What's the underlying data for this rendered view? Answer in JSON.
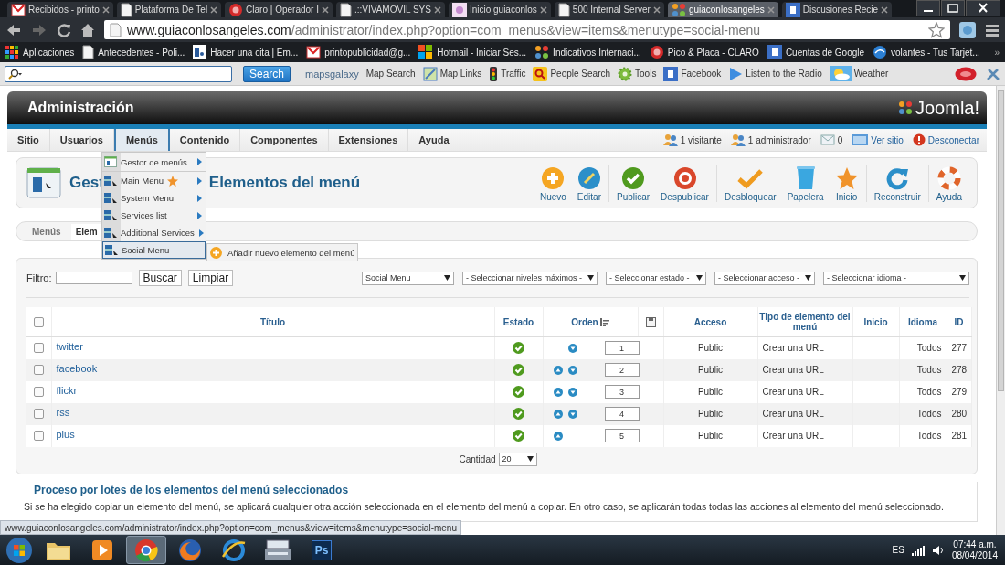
{
  "browser": {
    "tabs": [
      {
        "title": "Recibidos - printo",
        "kind": "mail",
        "selected": false
      },
      {
        "title": "Plataforma De Tel",
        "kind": "page",
        "selected": false
      },
      {
        "title": "Claro | Operador I",
        "kind": "circle",
        "selected": false
      },
      {
        "title": ".::VIVAMOVIL SYS",
        "kind": "page",
        "selected": false
      },
      {
        "title": "Inicio guiaconlos",
        "kind": "flower",
        "selected": false
      },
      {
        "title": "500 Internal Server",
        "kind": "page",
        "selected": false
      },
      {
        "title": "guiaconlosangeles",
        "kind": "joomla",
        "selected": true
      },
      {
        "title": "Discusiones Recie",
        "kind": "square",
        "selected": false
      }
    ],
    "url": {
      "host": "www.guiaconlosangeles.com",
      "path": "/administrator/index.php?option=com_menus&view=items&menutype=social-menu"
    },
    "bookmarks": [
      {
        "label": "Aplicaciones",
        "kind": "apps"
      },
      {
        "label": "Antecedentes - Poli...",
        "kind": "page"
      },
      {
        "label": "Hacer una cita | Em...",
        "kind": "document"
      },
      {
        "label": "printopublicidad@g...",
        "kind": "mail"
      },
      {
        "label": "Hotmail - Iniciar Ses...",
        "kind": "grid"
      },
      {
        "label": "Indicativos Internaci...",
        "kind": "joomla"
      },
      {
        "label": "Pico & Placa - CLARO",
        "kind": "circle"
      },
      {
        "label": "Cuentas de Google",
        "kind": "square"
      },
      {
        "label": "volantes - Tus Tarjet...",
        "kind": "globe"
      }
    ],
    "bookmarks_more": "»"
  },
  "ask_toolbar": {
    "search_button": "Search",
    "logo": "mapsgalaxy",
    "items": [
      {
        "label": "Map Search",
        "kind": "text"
      },
      {
        "label": "Map Links",
        "kind": "map"
      },
      {
        "label": "Traffic",
        "kind": "traffic"
      },
      {
        "label": "People Search",
        "kind": "search"
      },
      {
        "label": "Tools",
        "kind": "gear"
      },
      {
        "label": "Facebook",
        "kind": "square"
      },
      {
        "label": "Listen to the Radio",
        "kind": "play"
      },
      {
        "label": "Weather",
        "kind": "weather"
      }
    ]
  },
  "header": {
    "title": "Administración",
    "logo": "Joomla!"
  },
  "menu": [
    {
      "label": "Sitio",
      "selected": false
    },
    {
      "label": "Usuarios",
      "selected": false
    },
    {
      "label": "Menús",
      "selected": true
    },
    {
      "label": "Contenido",
      "selected": false
    },
    {
      "label": "Componentes",
      "selected": false
    },
    {
      "label": "Extensiones",
      "selected": false
    },
    {
      "label": "Ayuda",
      "selected": false
    }
  ],
  "status": [
    {
      "label": "1 visitante",
      "kind": "users",
      "link": false
    },
    {
      "label": "1 administrador",
      "kind": "users",
      "link": false
    },
    {
      "label": "0",
      "kind": "mail",
      "link": false
    },
    {
      "label": "Ver sitio",
      "kind": "screen",
      "link": true
    },
    {
      "label": "Desconectar",
      "kind": "power",
      "link": true
    }
  ],
  "title": {
    "start": "Gest",
    "end": "Elementos del menú"
  },
  "toolbar": {
    "groups": [
      {
        "buttons": [
          {
            "label": "Nuevo",
            "kind": "new"
          },
          {
            "label": "Editar",
            "kind": "edit"
          }
        ]
      },
      {
        "buttons": [
          {
            "label": "Publicar",
            "kind": "publish"
          },
          {
            "label": "Despublicar",
            "kind": "unpublish"
          }
        ]
      },
      {
        "buttons": [
          {
            "label": "Desbloquear",
            "kind": "checkin"
          },
          {
            "label": "Papelera",
            "kind": "trash"
          },
          {
            "label": "Inicio",
            "kind": "star"
          }
        ]
      },
      {
        "buttons": [
          {
            "label": "Reconstruir",
            "kind": "refresh"
          }
        ]
      },
      {
        "buttons": [
          {
            "label": "Ayuda",
            "kind": "help"
          }
        ]
      }
    ]
  },
  "submenu": [
    {
      "label": "Menús",
      "selected": false
    },
    {
      "label": "Elem",
      "selected": true
    }
  ],
  "filter": {
    "label": "Filtro:",
    "buttons": [
      "Buscar",
      "Limpiar"
    ],
    "selects": [
      "Social Menu",
      "- Seleccionar niveles máximos -",
      "- Seleccionar estado -",
      "- Seleccionar acceso -",
      "- Seleccionar idioma -"
    ]
  },
  "table": {
    "select_all_checked": false,
    "columns": [
      {
        "label": "Título",
        "kind": "text"
      },
      {
        "label": "Estado",
        "kind": "text"
      },
      {
        "label": "Orden",
        "kind": "sort"
      },
      {
        "kind": "save"
      },
      {
        "label": "Acceso",
        "kind": "text"
      },
      {
        "label": "Tipo de elemento del menú",
        "kind": "text"
      },
      {
        "label": "Inicio",
        "kind": "text"
      },
      {
        "label": "Idioma",
        "kind": "text"
      },
      {
        "label": "ID",
        "kind": "text"
      }
    ],
    "rows": [
      {
        "title": "twitter",
        "checked": false,
        "published": true,
        "up": false,
        "down": true,
        "order": "1",
        "access": "Public",
        "type": "Crear una URL",
        "language": "Todos",
        "id": "277"
      },
      {
        "title": "facebook",
        "checked": false,
        "published": true,
        "up": true,
        "down": true,
        "order": "2",
        "access": "Public",
        "type": "Crear una URL",
        "language": "Todos",
        "id": "278"
      },
      {
        "title": "flickr",
        "checked": false,
        "published": true,
        "up": true,
        "down": true,
        "order": "3",
        "access": "Public",
        "type": "Crear una URL",
        "language": "Todos",
        "id": "279"
      },
      {
        "title": "rss",
        "checked": false,
        "published": true,
        "up": true,
        "down": true,
        "order": "4",
        "access": "Public",
        "type": "Crear una URL",
        "language": "Todos",
        "id": "280"
      },
      {
        "title": "plus",
        "checked": false,
        "published": true,
        "up": true,
        "down": false,
        "order": "5",
        "access": "Public",
        "type": "Crear una URL",
        "language": "Todos",
        "id": "281"
      }
    ]
  },
  "pagination": {
    "label": "Cantidad",
    "value": "20"
  },
  "batch": {
    "legend": "Proceso por lotes de los elementos del menú seleccionados",
    "text": "Si se ha elegido copiar un elemento del menú, se aplicará cualquier otra acción seleccionada en el elemento del menú a copiar. En otro caso, se aplicarán todas todas las acciones al elemento del menú seleccionado."
  },
  "dropdown": {
    "items": [
      {
        "label": "Gestor de menús",
        "kind": "manager",
        "default": false,
        "arrow": true,
        "selected": false
      },
      {
        "label": "Main Menu",
        "kind": "menu",
        "default": true,
        "arrow": true,
        "selected": false
      },
      {
        "label": "System Menu",
        "kind": "menu",
        "default": false,
        "arrow": true,
        "selected": false
      },
      {
        "label": "Services list",
        "kind": "menu",
        "default": false,
        "arrow": true,
        "selected": false
      },
      {
        "label": "Additional Services",
        "kind": "menu",
        "default": false,
        "arrow": true,
        "selected": false
      },
      {
        "label": "Social Menu",
        "kind": "menu",
        "default": false,
        "arrow": false,
        "selected": true
      }
    ],
    "submenu": [
      {
        "label": "Añadir nuevo elemento del menú"
      }
    ]
  },
  "status_url": "www.guiaconlosangeles.com/administrator/index.php?option=com_menus&view=items&menutype=social-menu",
  "taskbar": {
    "apps": [
      {
        "kind": "folder",
        "selected": false
      },
      {
        "kind": "media",
        "selected": false
      },
      {
        "kind": "chrome",
        "selected": true
      },
      {
        "kind": "firefox",
        "selected": false
      },
      {
        "kind": "ie",
        "selected": false
      },
      {
        "kind": "register",
        "selected": false
      },
      {
        "kind": "photoshop",
        "label": "Ps",
        "selected": false
      }
    ],
    "language": "ES",
    "time": "07:44 a.m.",
    "date": "08/04/2014"
  }
}
